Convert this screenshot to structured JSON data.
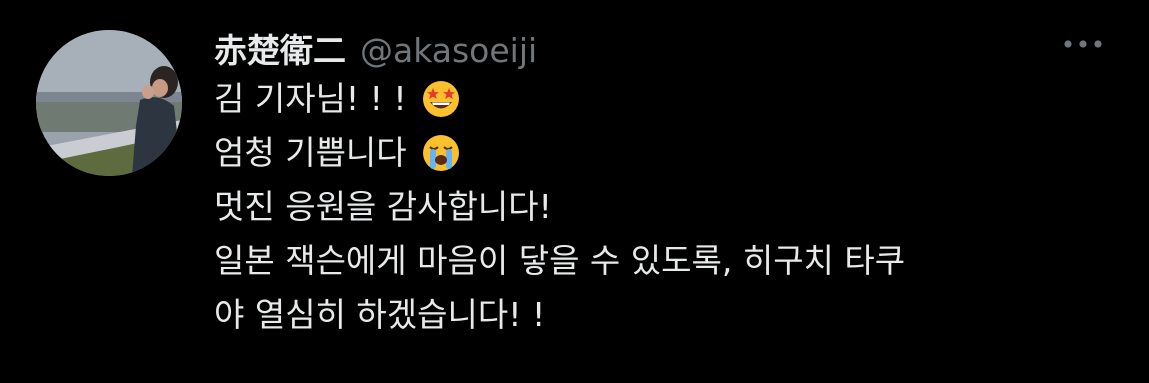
{
  "tweet": {
    "author": {
      "display_name": "赤楚衛二",
      "handle": "@akasoeiji"
    },
    "more_icon": "more-horizontal-icon",
    "lines": [
      {
        "text": "김 기자님! ! !",
        "emoji": "star-struck-emoji"
      },
      {
        "text": "엄청 기쁩니다",
        "emoji": "loudly-crying-emoji"
      },
      {
        "text": "멋진 응원을 감사합니다!"
      },
      {
        "text": "일본 잭슨에게 마음이 닿을 수 있도록, 히구치 타쿠"
      },
      {
        "text": "야 열심히 하겠습니다! !"
      }
    ]
  },
  "colors": {
    "background": "#000000",
    "text_primary": "#e7e9ea",
    "text_secondary": "#71767b",
    "emoji_yellow": "#fbc02d",
    "emoji_tear": "#64b5f6"
  }
}
